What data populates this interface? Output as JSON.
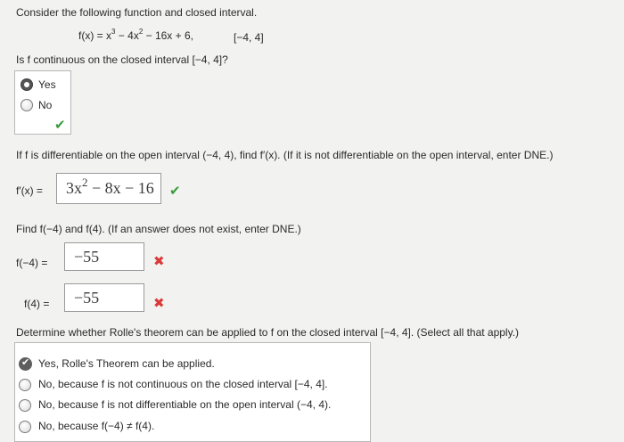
{
  "question": {
    "intro": "Consider the following function and closed interval.",
    "function_lhs": "f(x) = x",
    "function_exp1": "3",
    "function_mid": " − 4x",
    "function_exp2": "2",
    "function_rest": " − 16x + 6,",
    "interval": "[−4, 4]"
  },
  "part1": {
    "prompt": "Is f continuous on the closed interval [−4, 4]?",
    "options": [
      {
        "label": "Yes",
        "selected": true
      },
      {
        "label": "No",
        "selected": false
      }
    ],
    "result_icon": "check-icon"
  },
  "part2": {
    "prompt": "If f is differentiable on the open interval (−4, 4), find f′(x). (If it is not differentiable on the open interval, enter DNE.)",
    "lhs": "f′(x) =",
    "answer_coef": "3x",
    "answer_exp": "2",
    "answer_rest": " − 8x − 16",
    "result_icon": "check-icon"
  },
  "part3": {
    "prompt": "Find f(−4) and f(4). (If an answer does not exist, enter DNE.)",
    "a_label": "f(−4)  =",
    "a_value": "−55",
    "a_result_icon": "x-icon",
    "b_label": "f(4)  =",
    "b_value": "−55",
    "b_result_icon": "x-icon"
  },
  "part4": {
    "prompt": "Determine whether Rolle's theorem can be applied to f on the closed interval [−4, 4]. (Select all that apply.)",
    "options": [
      {
        "label": "Yes, Rolle's Theorem can be applied.",
        "selected": true
      },
      {
        "label": "No, because f is not continuous on the closed interval [−4, 4].",
        "selected": false
      },
      {
        "label": "No, because f is not differentiable on the open interval (−4, 4).",
        "selected": false
      },
      {
        "label": "No, because f(−4) ≠ f(4).",
        "selected": false
      }
    ]
  },
  "colors": {
    "correct": "#3a9a3a",
    "incorrect": "#d93a3a"
  }
}
